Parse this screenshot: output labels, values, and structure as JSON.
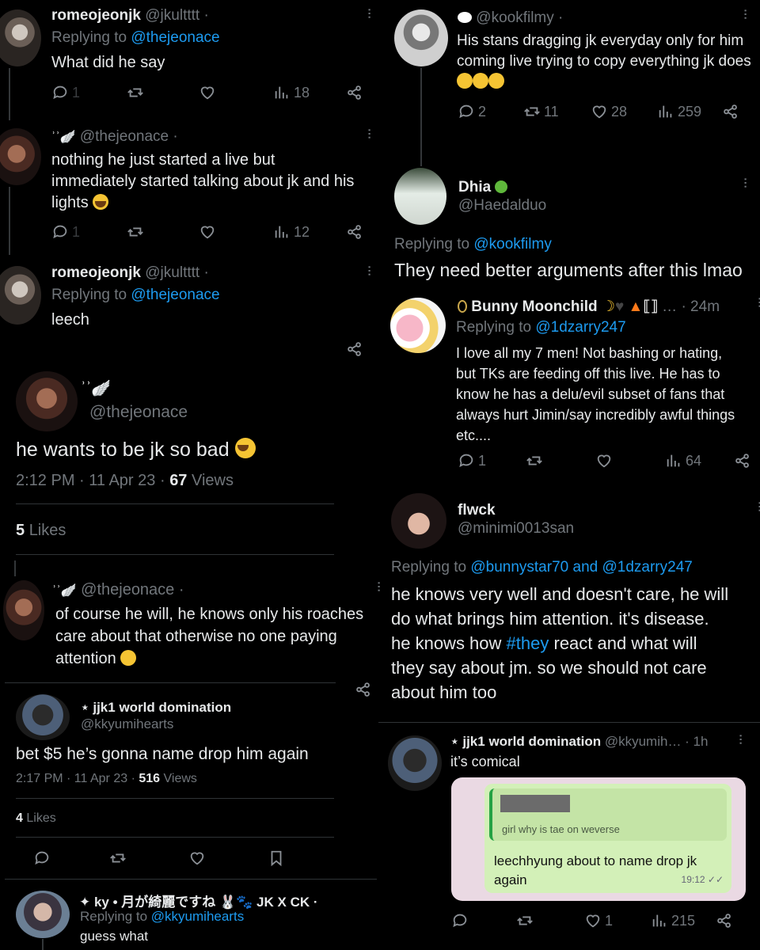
{
  "left": {
    "t1": {
      "name": "romeojeonjk",
      "handle": "@jkultttt ·",
      "replying_label": "Replying to",
      "replying_to": "@thejeonace",
      "text": "What did he say",
      "replies": "1",
      "views": "18"
    },
    "t2": {
      "handle": "@thejeonace ·",
      "text_l1": "nothing he just started a live but",
      "text_l2": "immediately started talking about jk and his",
      "text_l3": "lights",
      "replies": "1",
      "views": "12"
    },
    "t3": {
      "name": "romeojeonjk",
      "handle": "@jkultttt ·",
      "replying_label": "Replying to",
      "replying_to": "@thejeonace",
      "text": "leech"
    },
    "focus": {
      "handle": "@thejeonace",
      "text": "he wants to be jk so bad",
      "time": "2:12 PM · 11 Apr 23 ·",
      "views_count": "67",
      "views_label": "Views",
      "likes_count": "5",
      "likes_label": "Likes"
    },
    "t4": {
      "handle": "@thejeonace ·",
      "text_l1": "of course he will, he knows only his roaches",
      "text_l2": "care about that otherwise no one paying",
      "text_l3": "attention"
    },
    "t5": {
      "name": "⋆ jjk1 world domination",
      "handle": "@kkyumihearts",
      "text": "bet $5 he’s gonna name drop him again",
      "time": "2:17 PM · 11 Apr 23 ·",
      "views_count": "516",
      "views_label": "Views",
      "likes_count": "4",
      "likes_label": "Likes"
    },
    "t6": {
      "name": "✦ ky • 月が綺麗ですね 🐰🐾 JK X CK ·",
      "replying_label": "Replying to",
      "replying_to": "@kkyumihearts",
      "text": "guess what"
    }
  },
  "right": {
    "r1": {
      "handle": "@kookfilmy ·",
      "text_l1": "His stans dragging jk everyday only for him",
      "text_l2": "coming live trying to copy everything jk does",
      "replies": "2",
      "retweets": "11",
      "likes": "28",
      "views": "259"
    },
    "r2": {
      "name": "Dhia",
      "handle": "@Haedalduo",
      "replying_label": "Replying to",
      "replying_to": "@kookfilmy",
      "text": "They need better arguments after this lmao"
    },
    "r3": {
      "name": "Bunny Moonchild",
      "name_suffix": "… · 24m",
      "replying_label": "Replying to",
      "replying_to": "@1dzarry247",
      "text_l1": "I love all my 7 men! Not bashing or hating,",
      "text_l2": "but TKs are feeding off this live. He has to",
      "text_l3": "know he has a delu/evil subset of fans that",
      "text_l4": "always hurt Jimin/say incredibly awful things",
      "text_l5": "etc....",
      "replies": "1",
      "views": "64"
    },
    "r4": {
      "name": "flwck",
      "handle": "@minimi0013san",
      "replying_label": "Replying to",
      "replying_to_1": "@bunnystar70",
      "and": "and",
      "replying_to_2": "@1dzarry247",
      "text_l1": "he knows very well and doesn't care, he will",
      "text_l2": "do what brings him attention. it's disease.",
      "text_l3a": "he knows how",
      "hashtag": "#they",
      "text_l3b": "react and what will",
      "text_l4": "they say about jm. so we should not care",
      "text_l5": "about him too"
    },
    "r5": {
      "name": "⋆ jjk1 world domination",
      "handle": "@kkyumih… · 1h",
      "text": "it’s comical",
      "chat_quote": "girl why is tae on weverse",
      "chat_msg_l1": "leechhyung about to name drop jk",
      "chat_msg_l2": "again",
      "chat_time": "19:12",
      "likes": "1",
      "views": "215"
    }
  }
}
